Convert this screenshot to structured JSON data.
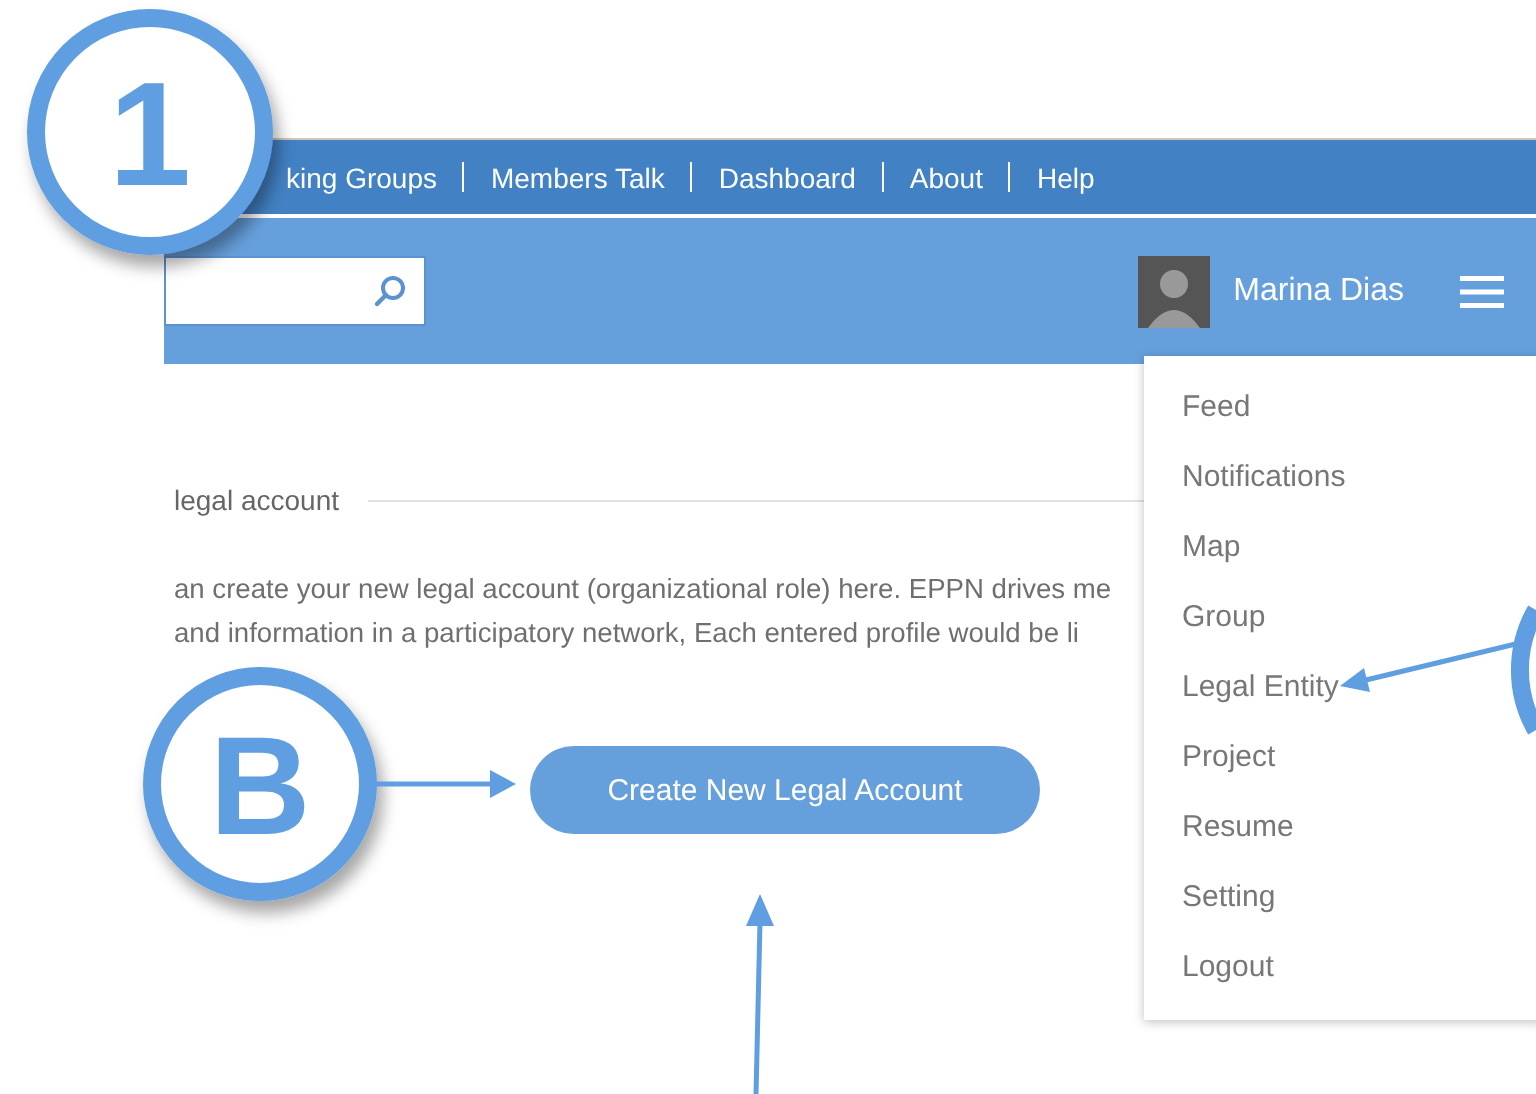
{
  "nav": {
    "links": [
      "king Groups",
      "Members Talk",
      "Dashboard",
      "About",
      "Help"
    ]
  },
  "header": {
    "user_name": "Marina Dias"
  },
  "user_menu": {
    "items": [
      "Feed",
      "Notifications",
      "Map",
      "Group",
      "Legal Entity",
      "Project",
      "Resume",
      "Setting",
      "Logout"
    ]
  },
  "content": {
    "heading": "legal account",
    "paragraph_lines": [
      "an create your new legal account (organizational role) here. EPPN drives me",
      "and information in a participatory network, Each entered profile would be li"
    ],
    "button": "Create New Legal Account"
  },
  "callouts": [
    {
      "label": "1"
    },
    {
      "label": "B"
    }
  ]
}
